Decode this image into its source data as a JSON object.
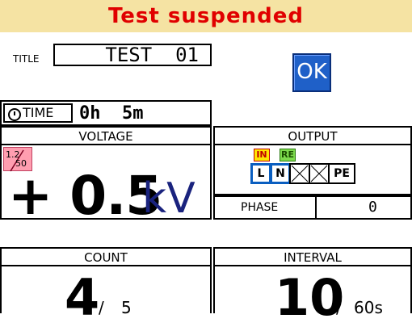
{
  "status": {
    "text": "Test suspended"
  },
  "title": {
    "label": "TITLE",
    "value": "TEST  01"
  },
  "ok_button": {
    "label": "OK"
  },
  "time": {
    "label": "TIME",
    "value": "0h  5m"
  },
  "voltage": {
    "header": "VOLTAGE",
    "ratio_top": "1.2",
    "ratio_bottom": "50",
    "value": "+ 0.5",
    "unit": "kV"
  },
  "output": {
    "header": "OUTPUT",
    "in_tag": "IN",
    "re_tag": "RE",
    "conductors": [
      "L",
      "N",
      "",
      "",
      "PE"
    ]
  },
  "phase": {
    "label": "PHASE",
    "value": "0"
  },
  "count": {
    "header": "COUNT",
    "current": "4",
    "separator": "/",
    "total": "5"
  },
  "interval": {
    "header": "INTERVAL",
    "current": "10",
    "separator": "/",
    "total": "60s"
  },
  "colors": {
    "status_bg": "#f5e3a3",
    "status_text": "#e00000",
    "ok_bg": "#1f60c8",
    "unit_color": "#1a237e",
    "ratio_bg": "#ff9eb0"
  }
}
